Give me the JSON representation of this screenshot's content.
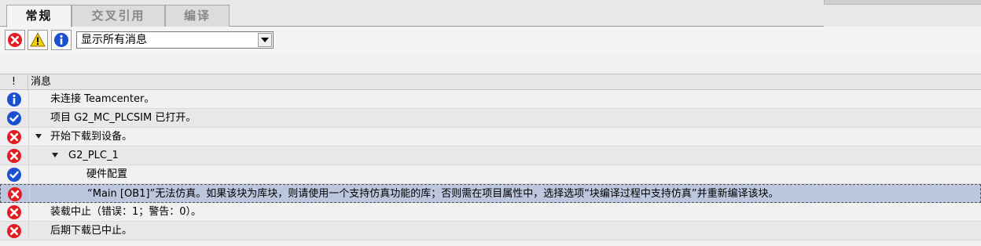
{
  "tabs": [
    {
      "label": "常规",
      "active": true
    },
    {
      "label": "交叉引用",
      "active": false
    },
    {
      "label": "编译",
      "active": false
    }
  ],
  "toolbar": {
    "buttons": [
      {
        "icon": "error-filter-icon",
        "color": "#e31b23"
      },
      {
        "icon": "warning-filter-icon",
        "color": "#f5d000"
      },
      {
        "icon": "info-filter-icon",
        "color": "#1a4fcf"
      }
    ],
    "filter_value": "显示所有消息"
  },
  "grid": {
    "header_status": "!",
    "header_message": "消息",
    "rows": [
      {
        "status": "info",
        "indent": 0,
        "expander": false,
        "text": "未连接 Teamcenter。"
      },
      {
        "status": "ok",
        "indent": 0,
        "expander": false,
        "text": "项目 G2_MC_PLCSIM 已打开。"
      },
      {
        "status": "error",
        "indent": 0,
        "expander": true,
        "text": "开始下载到设备。"
      },
      {
        "status": "error",
        "indent": 1,
        "expander": true,
        "text": "G2_PLC_1"
      },
      {
        "status": "ok",
        "indent": 2,
        "expander": false,
        "text": "硬件配置"
      },
      {
        "status": "error",
        "indent": 2,
        "expander": false,
        "selected": true,
        "text": "“Main [OB1]”无法仿真。如果该块为库块，则请使用一个支持仿真功能的库；否则需在项目属性中，选择选项“块编译过程中支持仿真”并重新编译该块。"
      },
      {
        "status": "error",
        "indent": 0,
        "expander": false,
        "text": "装载中止（错误：1；警告：0）。"
      },
      {
        "status": "error",
        "indent": 0,
        "expander": false,
        "text": "后期下载已中止。"
      }
    ]
  },
  "colors": {
    "error": "#e31b23",
    "ok": "#1a4fcf",
    "info": "#1a4fcf",
    "selection": "#bcc6dd"
  }
}
